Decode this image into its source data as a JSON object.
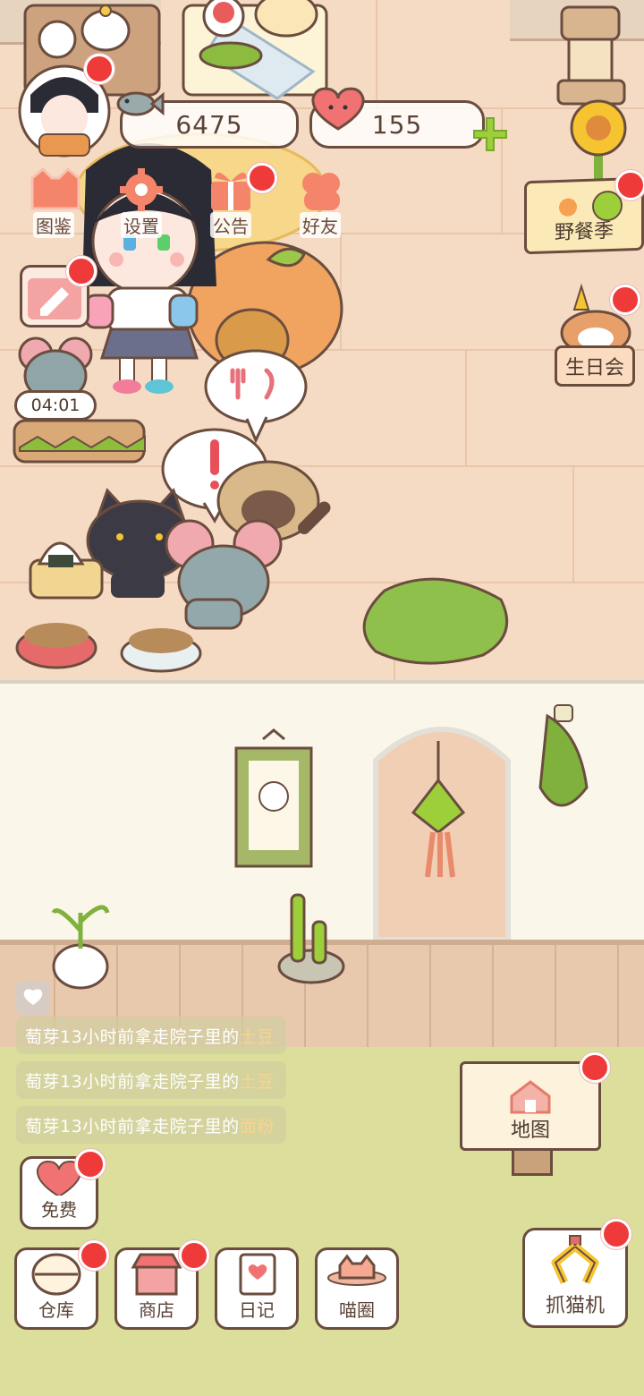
{
  "currency": {
    "fish_count": "6475",
    "heart_count": "155"
  },
  "top_menu": [
    {
      "label": "图鉴",
      "icon": "cat-book-icon"
    },
    {
      "label": "设置",
      "icon": "gear-icon"
    },
    {
      "label": "公告",
      "icon": "gift-icon"
    },
    {
      "label": "好友",
      "icon": "friends-icon"
    }
  ],
  "events": {
    "picnic_label": "野餐季",
    "birthday_label": "生日会"
  },
  "timer": {
    "value": "04:01"
  },
  "feed": [
    {
      "prefix": "萄芽13小时前拿走院子里的",
      "item": "土豆"
    },
    {
      "prefix": "萄芽13小时前拿走院子里的",
      "item": "土豆"
    },
    {
      "prefix": "萄芽13小时前拿走院子里的",
      "item": "面粉"
    }
  ],
  "map_label": "地图",
  "free_label": "免费",
  "bottom_bar": [
    {
      "label": "仓库",
      "icon": "storage-icon"
    },
    {
      "label": "商店",
      "icon": "shop-icon"
    },
    {
      "label": "日记",
      "icon": "diary-icon"
    },
    {
      "label": "喵圈",
      "icon": "cat-planet-icon"
    }
  ],
  "claw_label": "抓猫机",
  "colors": {
    "badge": "#ef3a3a",
    "outline": "#6b4d3f",
    "accent_green": "#9ccf3a"
  }
}
